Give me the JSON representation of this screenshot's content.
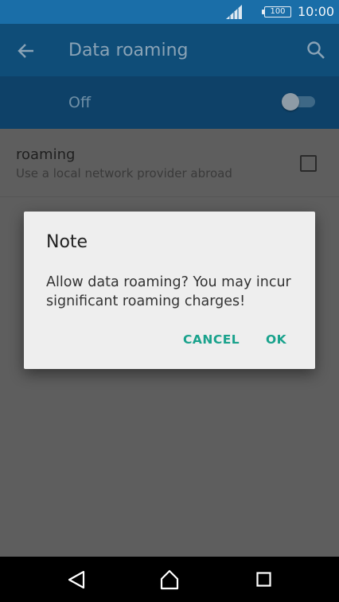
{
  "status_bar": {
    "battery_level": "100",
    "time": "10:00",
    "icons": [
      "signal-icon",
      "battery-icon"
    ]
  },
  "app_bar": {
    "title": "Data roaming",
    "icons": [
      "back-arrow-icon",
      "search-icon"
    ]
  },
  "master_switch": {
    "label": "Off",
    "state": "off"
  },
  "settings": {
    "roaming": {
      "title": "roaming",
      "summary": "Use a local network provider abroad",
      "checked": false
    }
  },
  "dialog": {
    "title": "Note",
    "message": "Allow data roaming? You may incur significant roaming charges!",
    "cancel_label": "CANCEL",
    "ok_label": "OK"
  },
  "nav_bar": {
    "icons": [
      "nav-back-icon",
      "home-icon",
      "recents-icon"
    ]
  },
  "colors": {
    "status_bar": "#1a6ea8",
    "app_bar": "#0f4d78",
    "accent": "#19a28c",
    "dialog_background": "#eeeeee"
  }
}
